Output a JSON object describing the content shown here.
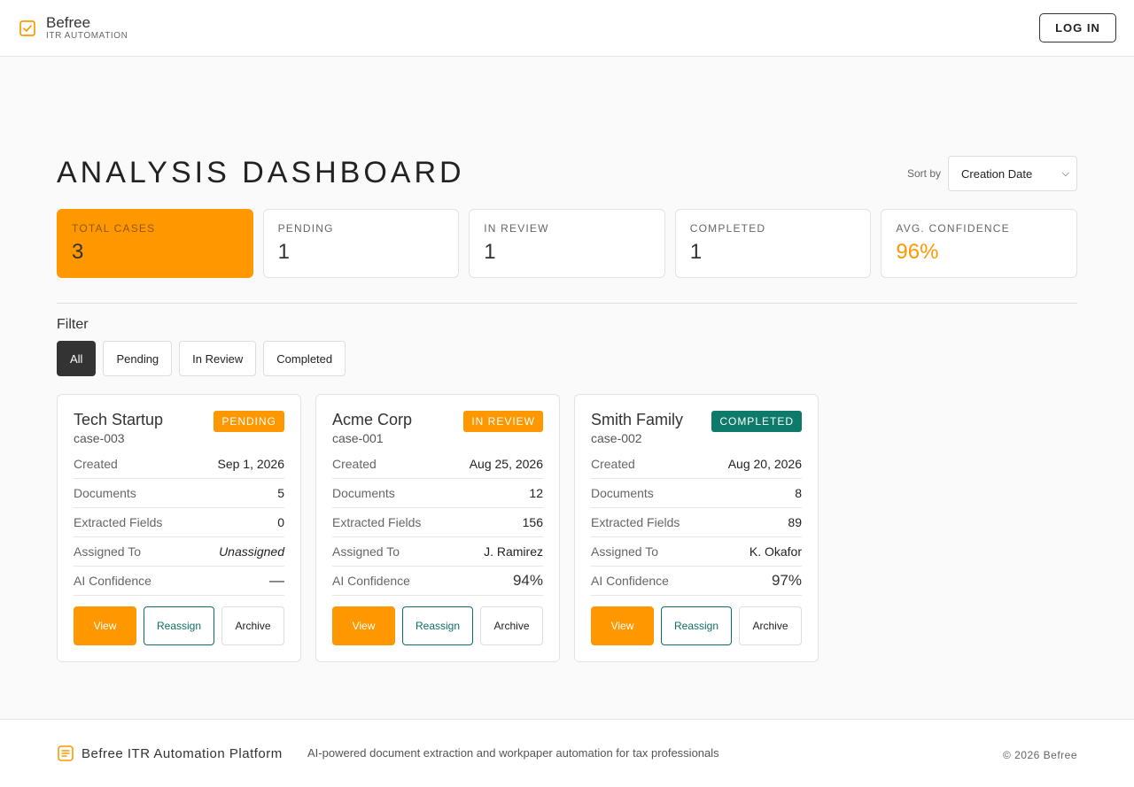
{
  "header": {
    "brand_name": "Befree",
    "brand_sub": "ITR AUTOMATION",
    "login_label": "LOG IN"
  },
  "page": {
    "title": "ANALYSIS DASHBOARD",
    "sort_label": "Sort by",
    "sort_value": "Creation Date"
  },
  "stats": [
    {
      "label": "TOTAL CASES",
      "value": "3"
    },
    {
      "label": "PENDING",
      "value": "1"
    },
    {
      "label": "IN REVIEW",
      "value": "1"
    },
    {
      "label": "COMPLETED",
      "value": "1"
    },
    {
      "label": "AVG. CONFIDENCE",
      "value": "96%"
    }
  ],
  "filter": {
    "title": "Filter",
    "options": [
      "All",
      "Pending",
      "In Review",
      "Completed"
    ],
    "selected": "All"
  },
  "row_labels": {
    "created": "Created",
    "documents": "Documents",
    "fields": "Extracted Fields",
    "assigned": "Assigned To",
    "confidence": "AI Confidence"
  },
  "actions": {
    "view": "View",
    "reassign": "Reassign",
    "archive": "Archive"
  },
  "cases": [
    {
      "name": "Tech Startup",
      "id": "case-003",
      "status": "PENDING",
      "status_color": "#ff9800",
      "created": "Sep 1, 2026",
      "documents": "5",
      "fields": "0",
      "assigned": "Unassigned",
      "confidence": "—"
    },
    {
      "name": "Acme Corp",
      "id": "case-001",
      "status": "IN REVIEW",
      "status_color": "#ff9800",
      "created": "Aug 25, 2026",
      "documents": "12",
      "fields": "156",
      "assigned": "J. Ramirez",
      "confidence": "94%"
    },
    {
      "name": "Smith Family",
      "id": "case-002",
      "status": "COMPLETED",
      "status_color": "#0e7a6a",
      "created": "Aug 20, 2026",
      "documents": "8",
      "fields": "89",
      "assigned": "K. Okafor",
      "confidence": "97%"
    }
  ],
  "footer": {
    "name": "Befree ITR Automation Platform",
    "tagline": "AI-powered document extraction and workpaper automation for tax professionals",
    "copyright": "© 2026 Befree"
  },
  "colors": {
    "accent": "#ff9800",
    "teal": "#0e6e64",
    "dark": "#333333"
  }
}
